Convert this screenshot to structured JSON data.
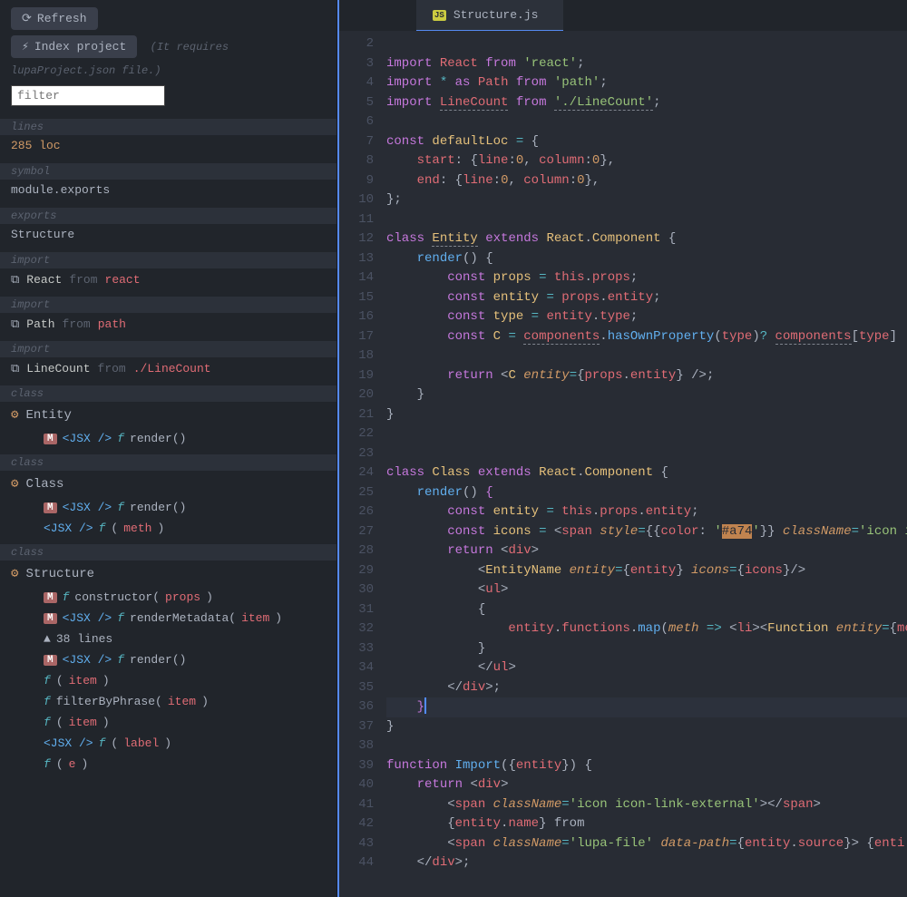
{
  "toolbar": {
    "refresh_label": "Refresh",
    "index_label": "Index project",
    "requires_text": "(It requires lupaProject.json file.)",
    "filter_placeholder": "filter"
  },
  "sections": {
    "lines_label": "lines",
    "lines_value": "285 loc",
    "symbol_label": "symbol",
    "symbol_value": "module.exports",
    "exports_label": "exports",
    "exports_value": "Structure",
    "import_label": "import",
    "class_label": "class"
  },
  "imports": [
    {
      "name": "React",
      "from_kw": "from",
      "pkg": "react"
    },
    {
      "name": "Path",
      "from_kw": "from",
      "pkg": "path"
    },
    {
      "name": "LineCount",
      "from_kw": "from",
      "pkg": "./LineCount"
    }
  ],
  "classes": [
    {
      "name": "Entity",
      "members": [
        {
          "badge": "M",
          "jsx": "<JSX />",
          "f": "f",
          "name": "render()"
        }
      ]
    },
    {
      "name": "Class",
      "members": [
        {
          "badge": "M",
          "jsx": "<JSX />",
          "f": "f",
          "name": "render()"
        },
        {
          "jsx": "<JSX />",
          "f": "f",
          "name": "(",
          "param": "meth",
          "close": ")"
        }
      ]
    },
    {
      "name": "Structure",
      "members": [
        {
          "badge": "M",
          "f": "f",
          "name": "constructor(",
          "param": "props",
          "close": ")"
        },
        {
          "badge": "M",
          "jsx": "<JSX />",
          "f": "f",
          "name": "renderMetadata(",
          "param": "item",
          "close": ")"
        },
        {
          "warn": true,
          "lines": "38 lines"
        },
        {
          "badge": "M",
          "jsx": "<JSX />",
          "f": "f",
          "name": "render()"
        },
        {
          "f": "f",
          "name": "(",
          "param": "item",
          "close": ")"
        },
        {
          "f": "f",
          "name": "filterByPhrase(",
          "param": "item",
          "close": ")"
        },
        {
          "f": "f",
          "name": "(",
          "param": "item",
          "close": ")"
        },
        {
          "jsx": "<JSX />",
          "f": "f",
          "name": "(",
          "param": "label",
          "close": ")"
        },
        {
          "f": "f",
          "name": "(",
          "param": "e",
          "close": ")"
        }
      ]
    }
  ],
  "tab": {
    "filename": "Structure.js"
  },
  "code": {
    "start": 2,
    "lines": [
      {
        "n": 2,
        "html": ""
      },
      {
        "n": 3,
        "html": "<span class='c-kw'>import</span> <span class='c-def'>React</span> <span class='c-kw'>from</span> <span class='c-str'>'react'</span><span class='c-punc'>;</span>"
      },
      {
        "n": 4,
        "html": "<span class='c-kw'>import</span> <span class='c-op'>*</span> <span class='c-kw'>as</span> <span class='c-def'>Path</span> <span class='c-kw'>from</span> <span class='c-str'>'path'</span><span class='c-punc'>;</span>"
      },
      {
        "n": 5,
        "dot": true,
        "html": "<span class='c-kw'>import</span> <span class='c-def c-dashed'>LineCount</span> <span class='c-kw'>from</span> <span class='c-str c-dashed'>'./LineCount'</span><span class='c-punc'>;</span>"
      },
      {
        "n": 6,
        "html": ""
      },
      {
        "n": 7,
        "html": "<span class='c-kw'>const</span> <span class='c-ident'>defaultLoc</span> <span class='c-op'>=</span> <span class='c-punc'>{</span>"
      },
      {
        "n": 8,
        "html": "    <span class='c-prop'>start</span><span class='c-punc'>:</span> <span class='c-punc'>{</span><span class='c-prop'>line</span><span class='c-punc'>:</span><span class='c-num'>0</span><span class='c-punc'>,</span> <span class='c-prop'>column</span><span class='c-punc'>:</span><span class='c-num'>0</span><span class='c-punc'>},</span>"
      },
      {
        "n": 9,
        "html": "    <span class='c-prop'>end</span><span class='c-punc'>:</span> <span class='c-punc'>{</span><span class='c-prop'>line</span><span class='c-punc'>:</span><span class='c-num'>0</span><span class='c-punc'>,</span> <span class='c-prop'>column</span><span class='c-punc'>:</span><span class='c-num'>0</span><span class='c-punc'>},</span>"
      },
      {
        "n": 10,
        "html": "<span class='c-punc'>};</span>"
      },
      {
        "n": 11,
        "html": ""
      },
      {
        "n": 12,
        "dot": true,
        "html": "<span class='c-kw'>class</span> <span class='c-ident c-dashed'>Entity</span> <span class='c-kw'>extends</span> <span class='c-ident'>React</span><span class='c-punc'>.</span><span class='c-comp'>Component</span> <span class='c-punc'>{</span>"
      },
      {
        "n": 13,
        "html": "    <span class='c-fn'>render</span><span class='c-punc'>() {</span>"
      },
      {
        "n": 14,
        "html": "        <span class='c-kw'>const</span> <span class='c-ident'>props</span> <span class='c-op'>=</span> <span class='c-this'>this</span><span class='c-punc'>.</span><span class='c-def'>props</span><span class='c-punc'>;</span>"
      },
      {
        "n": 15,
        "html": "        <span class='c-kw'>const</span> <span class='c-ident'>entity</span> <span class='c-op'>=</span> <span class='c-def'>props</span><span class='c-punc'>.</span><span class='c-def'>entity</span><span class='c-punc'>;</span>"
      },
      {
        "n": 16,
        "html": "        <span class='c-kw'>const</span> <span class='c-ident'>type</span> <span class='c-op'>=</span> <span class='c-def'>entity</span><span class='c-punc'>.</span><span class='c-def'>type</span><span class='c-punc'>;</span>"
      },
      {
        "n": 17,
        "dot": true,
        "html": "        <span class='c-kw'>const</span> <span class='c-ident'>C</span> <span class='c-op'>=</span> <span class='c-def c-dashed'>components</span><span class='c-punc'>.</span><span class='c-fn'>hasOwnProperty</span><span class='c-punc'>(</span><span class='c-def'>type</span><span class='c-punc'>)</span><span class='c-op'>?</span> <span class='c-def c-dashed'>components</span><span class='c-punc'>[</span><span class='c-def'>type</span><span class='c-punc'>]</span> <span class='c-op'>:</span>"
      },
      {
        "n": 18,
        "html": ""
      },
      {
        "n": 19,
        "html": "        <span class='c-kw'>return</span> <span class='c-punc'>&lt;</span><span class='c-comp'>C</span> <span class='c-attr'>entity</span><span class='c-op'>=</span><span class='c-punc'>{</span><span class='c-def'>props</span><span class='c-punc'>.</span><span class='c-def'>entity</span><span class='c-punc'>}</span> <span class='c-punc'>/&gt;;</span>"
      },
      {
        "n": 20,
        "html": "    <span class='c-punc'>}</span>"
      },
      {
        "n": 21,
        "html": "<span class='c-punc'>}</span>"
      },
      {
        "n": 22,
        "html": ""
      },
      {
        "n": 23,
        "html": ""
      },
      {
        "n": 24,
        "html": "<span class='c-kw'>class</span> <span class='c-ident'>Class</span> <span class='c-kw'>extends</span> <span class='c-ident'>React</span><span class='c-punc'>.</span><span class='c-comp'>Component</span> <span class='c-punc'>{</span>"
      },
      {
        "n": 25,
        "html": "    <span class='c-fn'>render</span><span class='c-punc'>() </span><span class='c-punc' style='color:#c678dd'>{</span>"
      },
      {
        "n": 26,
        "html": "        <span class='c-kw'>const</span> <span class='c-ident'>entity</span> <span class='c-op'>=</span> <span class='c-this'>this</span><span class='c-punc'>.</span><span class='c-def'>props</span><span class='c-punc'>.</span><span class='c-def'>entity</span><span class='c-punc'>;</span>"
      },
      {
        "n": 27,
        "html": "        <span class='c-kw'>const</span> <span class='c-ident'>icons</span> <span class='c-op'>=</span> <span class='c-punc'>&lt;</span><span class='c-jsx'>span</span> <span class='c-attr'>style</span><span class='c-op'>=</span><span class='c-punc'>{{</span><span class='c-def'>color</span><span class='c-punc'>:</span> <span class='c-str'>'</span><span class='hl'>#a74</span><span class='c-str'>'</span><span class='c-punc'>}}</span> <span class='c-attr'>className</span><span class='c-op'>=</span><span class='c-str'>'icon i</span>"
      },
      {
        "n": 28,
        "html": "        <span class='c-kw'>return</span> <span class='c-punc'>&lt;</span><span class='c-jsx'>div</span><span class='c-punc'>&gt;</span>"
      },
      {
        "n": 29,
        "html": "            <span class='c-punc'>&lt;</span><span class='c-comp'>EntityName</span> <span class='c-attr'>entity</span><span class='c-op'>=</span><span class='c-punc'>{</span><span class='c-def'>entity</span><span class='c-punc'>}</span> <span class='c-attr'>icons</span><span class='c-op'>=</span><span class='c-punc'>{</span><span class='c-def'>icons</span><span class='c-punc'>}/&gt;</span>"
      },
      {
        "n": 30,
        "html": "            <span class='c-punc'>&lt;</span><span class='c-jsx'>ul</span><span class='c-punc'>&gt;</span>"
      },
      {
        "n": 31,
        "html": "            <span class='c-punc'>{</span>"
      },
      {
        "n": 32,
        "html": "                <span class='c-def'>entity</span><span class='c-punc'>.</span><span class='c-def'>functions</span><span class='c-punc'>.</span><span class='c-fn'>map</span><span class='c-punc'>(</span><span class='c-attr'>meth</span> <span class='c-op'>=&gt;</span> <span class='c-punc'>&lt;</span><span class='c-jsx'>li</span><span class='c-punc'>&gt;&lt;</span><span class='c-comp'>Function</span> <span class='c-attr'>entity</span><span class='c-op'>=</span><span class='c-punc'>{</span><span class='c-def'>me</span>"
      },
      {
        "n": 33,
        "html": "            <span class='c-punc'>}</span>"
      },
      {
        "n": 34,
        "html": "            <span class='c-punc'>&lt;/</span><span class='c-jsx'>ul</span><span class='c-punc'>&gt;</span>"
      },
      {
        "n": 35,
        "html": "        <span class='c-punc'>&lt;/</span><span class='c-jsx'>div</span><span class='c-punc'>&gt;;</span>"
      },
      {
        "n": 36,
        "current": true,
        "html": "    <span class='c-punc' style='color:#c678dd'>}</span><span class='cursor'></span>"
      },
      {
        "n": 37,
        "html": "<span class='c-punc'>}</span>"
      },
      {
        "n": 38,
        "html": ""
      },
      {
        "n": 39,
        "html": "<span class='c-kw'>function</span> <span class='c-fn'>Import</span><span class='c-punc'>({</span><span class='c-def'>entity</span><span class='c-punc'>}) {</span>"
      },
      {
        "n": 40,
        "html": "    <span class='c-kw'>return</span> <span class='c-punc'>&lt;</span><span class='c-jsx'>div</span><span class='c-punc'>&gt;</span>"
      },
      {
        "n": 41,
        "html": "        <span class='c-punc'>&lt;</span><span class='c-jsx'>span</span> <span class='c-attr'>className</span><span class='c-op'>=</span><span class='c-str'>'icon icon-link-external'</span><span class='c-punc'>&gt;&lt;/</span><span class='c-jsx'>span</span><span class='c-punc'>&gt;</span>"
      },
      {
        "n": 42,
        "html": "        <span class='c-punc'>{</span><span class='c-def'>entity</span><span class='c-punc'>.</span><span class='c-def'>name</span><span class='c-punc'>}</span> from"
      },
      {
        "n": 43,
        "html": "        <span class='c-punc'>&lt;</span><span class='c-jsx'>span</span> <span class='c-attr'>className</span><span class='c-op'>=</span><span class='c-str'>'lupa-file'</span> <span class='c-attr'>data-path</span><span class='c-op'>=</span><span class='c-punc'>{</span><span class='c-def'>entity</span><span class='c-punc'>.</span><span class='c-def'>source</span><span class='c-punc'>}&gt;</span> <span class='c-punc'>{</span><span class='c-def'>enti</span>"
      },
      {
        "n": 44,
        "html": "    <span class='c-punc'>&lt;/</span><span class='c-jsx'>div</span><span class='c-punc'>&gt;;</span>"
      }
    ]
  }
}
